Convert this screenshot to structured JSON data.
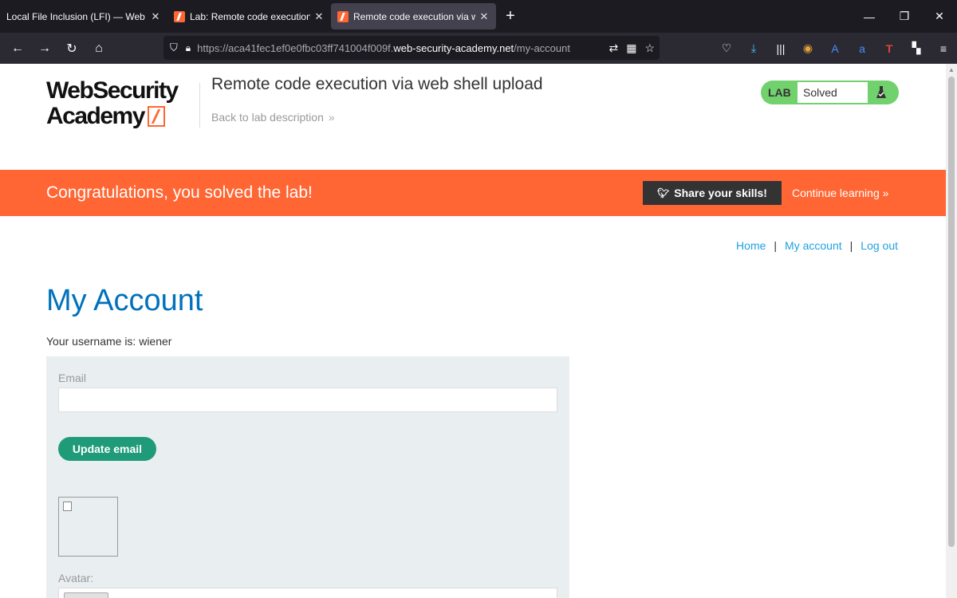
{
  "browser": {
    "tabs": [
      {
        "title": "Local File Inclusion (LFI) — Web App",
        "active": false,
        "favicon": false
      },
      {
        "title": "Lab: Remote code execution via",
        "active": false,
        "favicon": true
      },
      {
        "title": "Remote code execution via web",
        "active": true,
        "favicon": true
      }
    ],
    "url_prefix": "https://aca41fec1ef0e0fbc03ff741004f009f.",
    "url_domain": "web-security-academy.net",
    "url_path": "/my-account"
  },
  "header": {
    "logo_line1": "WebSecurity",
    "logo_line2": "Academy",
    "lab_title": "Remote code execution via web shell upload",
    "back_link": "Back to lab description",
    "lab_tag": "LAB",
    "lab_status": "Solved"
  },
  "banner": {
    "message": "Congratulations, you solved the lab!",
    "share": "Share your skills!",
    "continue": "Continue learning"
  },
  "nav": {
    "home": "Home",
    "sep": "|",
    "account": "My account",
    "logout": "Log out"
  },
  "account": {
    "title": "My Account",
    "username_line": "Your username is: wiener",
    "email_label": "Email",
    "email_value": "",
    "update_button": "Update email",
    "avatar_label": "Avatar:"
  },
  "colors": {
    "accent": "#ff6633",
    "link": "#1ea1e0",
    "heading": "#0071bc",
    "solved": "#70d16d",
    "button": "#1f9b7a"
  }
}
